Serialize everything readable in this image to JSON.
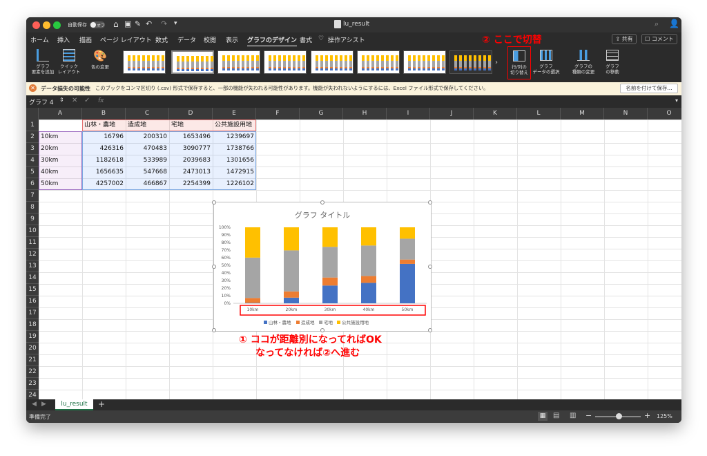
{
  "window": {
    "title": "lu_result",
    "autosave_label": "自動保存",
    "autosave_state": "オフ"
  },
  "tabs": [
    "ホーム",
    "挿入",
    "描画",
    "ページ レイアウト",
    "数式",
    "データ",
    "校閲",
    "表示",
    "グラフのデザイン",
    "書式",
    "操作アシスト"
  ],
  "active_tab": "グラフのデザイン",
  "share_label": "共有",
  "comment_label": "コメント",
  "ribbon": {
    "add_element": [
      "グラフ",
      "要素を追加"
    ],
    "quick_layout": [
      "クイック",
      "レイアウト"
    ],
    "change_color": "色の変更",
    "switch_row_col": [
      "行/列の",
      "切り替え"
    ],
    "select_data": [
      "グラフ",
      "データの選択"
    ],
    "change_type": [
      "グラフの",
      "種類の変更"
    ],
    "move_chart": [
      "グラフ",
      "の移動"
    ],
    "style_count": 8
  },
  "notice": {
    "title": "データ損失の可能性",
    "message": "このブックをコンマ区切り (.csv) 形式で保存すると、一部の機能が失われる可能性があります。機能が失われないようにするには、Excel ファイル形式で保存してください。",
    "button": "名前を付けて保存..."
  },
  "formula_bar": {
    "name_box": "グラフ 4",
    "fx": "fx"
  },
  "columns": [
    "A",
    "B",
    "C",
    "D",
    "E",
    "F",
    "G",
    "H",
    "I",
    "J",
    "K",
    "L",
    "M",
    "N",
    "O"
  ],
  "rows": [
    "1",
    "2",
    "3",
    "4",
    "5",
    "6",
    "7",
    "8",
    "9",
    "10",
    "11",
    "12",
    "13",
    "14",
    "15",
    "16",
    "17",
    "18",
    "19",
    "20",
    "21",
    "22",
    "23",
    "24"
  ],
  "table": {
    "headers": [
      "山林・農地",
      "造成地",
      "宅地",
      "公共施設用地"
    ],
    "rows": [
      [
        "10km",
        "16796",
        "200310",
        "1653496",
        "1239697"
      ],
      [
        "20km",
        "426316",
        "470483",
        "3090777",
        "1738766"
      ],
      [
        "30km",
        "1182618",
        "533989",
        "2039683",
        "1301656"
      ],
      [
        "40km",
        "1656635",
        "547668",
        "2473013",
        "1472915"
      ],
      [
        "50km",
        "4257002",
        "466867",
        "2254399",
        "1226102"
      ]
    ]
  },
  "chart_data": {
    "type": "bar",
    "stacked": "percent",
    "title": "グラフ タイトル",
    "categories": [
      "10km",
      "20km",
      "30km",
      "40km",
      "50km"
    ],
    "series": [
      {
        "name": "山林・農地",
        "color": "#4472c4",
        "values": [
          16796,
          426316,
          1182618,
          1656635,
          4257002
        ]
      },
      {
        "name": "造成地",
        "color": "#ed7d31",
        "values": [
          200310,
          470483,
          533989,
          547668,
          466867
        ]
      },
      {
        "name": "宅地",
        "color": "#a5a5a5",
        "values": [
          1653496,
          3090777,
          2039683,
          2473013,
          2254399
        ]
      },
      {
        "name": "公共施設用地",
        "color": "#ffc000",
        "values": [
          1239697,
          1738766,
          1301656,
          1472915,
          1226102
        ]
      }
    ],
    "yticks": [
      "100%",
      "90%",
      "80%",
      "70%",
      "60%",
      "50%",
      "40%",
      "30%",
      "20%",
      "10%",
      "0%"
    ],
    "ylim": [
      0,
      100
    ],
    "legend": "bottom"
  },
  "annotations": {
    "step2": "② ここで切替",
    "step1_line1": "① ココが距離別になってればOK",
    "step1_line2": "なってなければ②へ進む",
    "color": "#ff0000"
  },
  "sheet_tab": "lu_result",
  "status": {
    "ready": "準備完了",
    "zoom": "125%"
  }
}
